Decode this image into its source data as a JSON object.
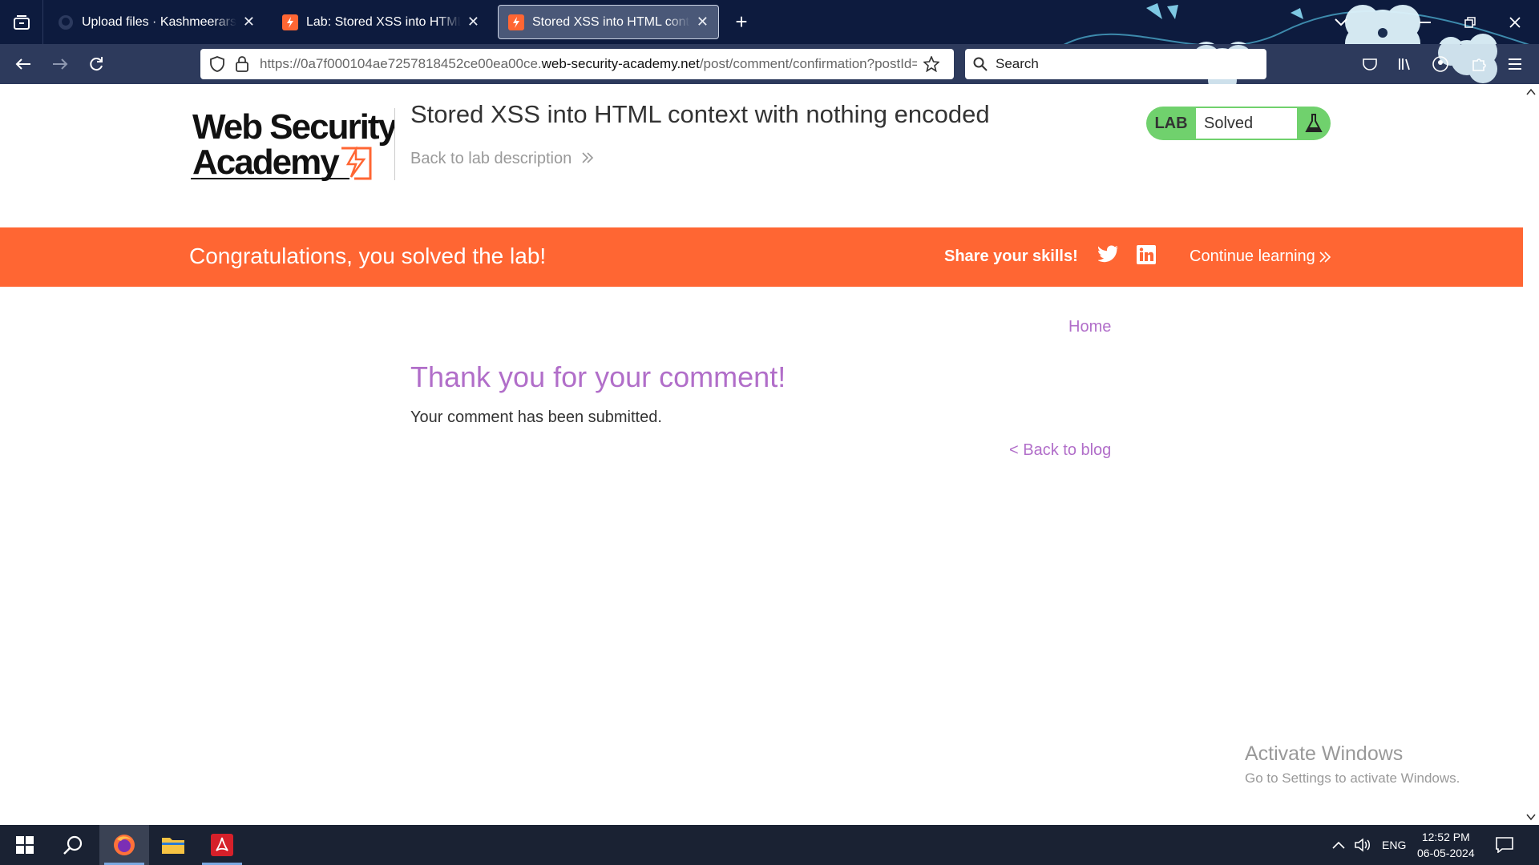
{
  "browser": {
    "tabs": [
      {
        "title": "Upload files · Kashmeerars/Kash",
        "favicon": "github-icon"
      },
      {
        "title": "Lab: Stored XSS into HTML cont",
        "favicon": "portswigger-icon"
      },
      {
        "title": "Stored XSS into HTML context w",
        "favicon": "portswigger-icon",
        "active": true
      }
    ],
    "url_prefix": "https://0a7f000104ae7257818452ce00ea00ce.",
    "url_host": "web-security-academy.net",
    "url_path": "/post/comment/confirmation?postId=",
    "search_placeholder": "Search"
  },
  "header": {
    "logo_line1": "Web Security",
    "logo_line2": "Academy",
    "lab_title": "Stored XSS into HTML context with nothing encoded",
    "back_to_description": "Back to lab description",
    "lab_status": {
      "tag": "LAB",
      "value": "Solved",
      "color": "#70d16d"
    }
  },
  "banner": {
    "message": "Congratulations, you solved the lab!",
    "share": "Share your skills!",
    "continue": "Continue learning",
    "color": "#ff6633"
  },
  "main": {
    "home": "Home",
    "heading": "Thank you for your comment!",
    "message": "Your comment has been submitted.",
    "back_to_blog": "< Back to blog",
    "link_color": "#b16ec9"
  },
  "watermark": {
    "title": "Activate Windows",
    "subtitle": "Go to Settings to activate Windows."
  },
  "taskbar": {
    "language": "ENG",
    "time": "12:52 PM",
    "date": "06-05-2024"
  }
}
